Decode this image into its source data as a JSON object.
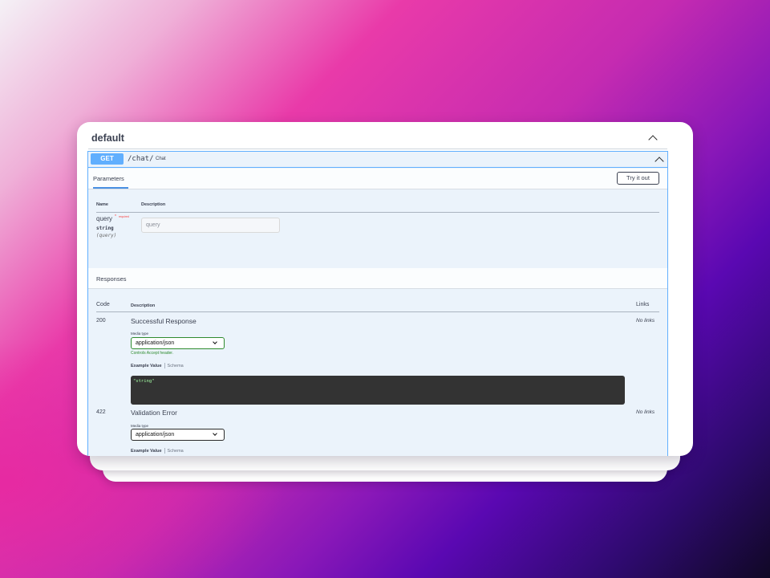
{
  "tag": {
    "title": "default"
  },
  "operation": {
    "method": "GET",
    "path": "/chat/",
    "summary": "Chat"
  },
  "parameters": {
    "tab_label": "Parameters",
    "try_label": "Try it out",
    "col_name": "Name",
    "col_description": "Description",
    "items": [
      {
        "name": "query",
        "required_star": "*",
        "required_text": "required",
        "type": "string",
        "in": "(query)",
        "placeholder": "query"
      }
    ]
  },
  "responses": {
    "title": "Responses",
    "col_code": "Code",
    "col_description": "Description",
    "col_links": "Links",
    "items": [
      {
        "code": "200",
        "description": "Successful Response",
        "media_type_label": "Media type",
        "media_type": "application/json",
        "accept_note": "Controls Accept header.",
        "example_tab": "Example Value",
        "schema_tab": "Schema",
        "example": "\"string\"",
        "links": "No links"
      },
      {
        "code": "422",
        "description": "Validation Error",
        "media_type_label": "Media type",
        "media_type": "application/json",
        "example_tab": "Example Value",
        "schema_tab": "Schema",
        "links": "No links"
      }
    ]
  },
  "colors": {
    "get_method": "#61affe",
    "required": "#f93e3e",
    "accept_note": "#2e8b2e",
    "code_background": "#333333"
  }
}
